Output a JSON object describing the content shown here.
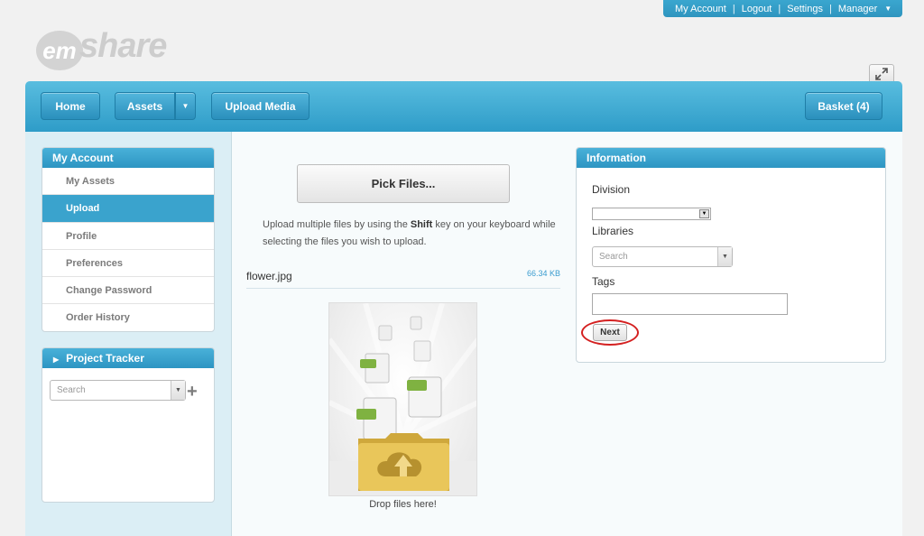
{
  "top_links": {
    "my_account": "My Account",
    "logout": "Logout",
    "settings": "Settings",
    "manager": "Manager"
  },
  "logo": {
    "prefix": "em",
    "name": "share"
  },
  "nav": {
    "home": "Home",
    "assets": "Assets",
    "upload_media": "Upload Media",
    "basket": "Basket (4)"
  },
  "sidebar": {
    "account_title": "My Account",
    "items": [
      {
        "label": "My Assets",
        "active": false
      },
      {
        "label": "Upload",
        "active": true
      },
      {
        "label": "Profile",
        "active": false
      },
      {
        "label": "Preferences",
        "active": false
      },
      {
        "label": "Change Password",
        "active": false
      },
      {
        "label": "Order History",
        "active": false
      }
    ],
    "project_title": "Project Tracker",
    "project_search_placeholder": "Search"
  },
  "upload": {
    "pick_button": "Pick Files...",
    "hint_pre": "Upload multiple files by using the ",
    "hint_key": "Shift",
    "hint_post": " key on your keyboard while selecting the files you wish to upload.",
    "file_name": "flower.jpg",
    "file_size": "66.34 KB",
    "drop_label": "Drop files here!"
  },
  "info": {
    "title": "Information",
    "division_label": "Division",
    "division_value": "",
    "libraries_label": "Libraries",
    "libraries_placeholder": "Search",
    "tags_label": "Tags",
    "tags_value": "",
    "next_button": "Next"
  },
  "colors": {
    "accent": "#2e9cc8",
    "annotation": "#d42020"
  }
}
